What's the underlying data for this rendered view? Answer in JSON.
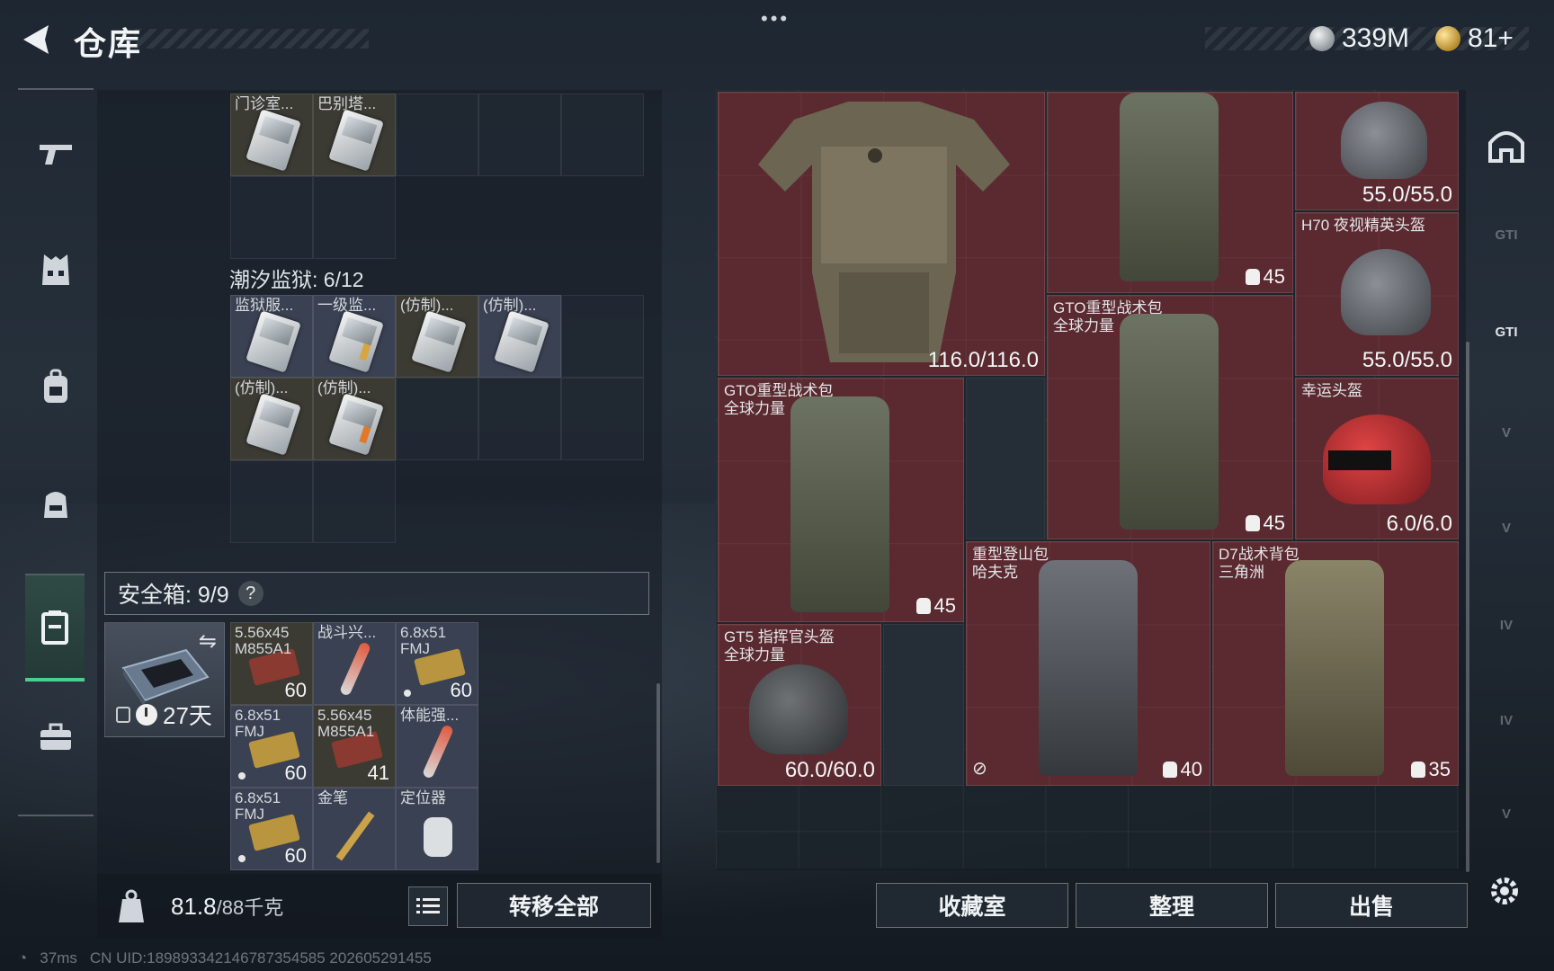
{
  "header": {
    "title": "仓库",
    "menu_dots": "•••",
    "currency": [
      {
        "name": "silver-coin-icon",
        "value": "339M"
      },
      {
        "name": "gold-coin-icon",
        "value": "81+"
      }
    ]
  },
  "stash": {
    "top_items": [
      {
        "label": "门诊室...",
        "style": "tan"
      },
      {
        "label": "巴别塔...",
        "style": "tan"
      }
    ],
    "section_title": "潮汐监狱: 6/12",
    "prison_items": [
      {
        "label": "监狱服...",
        "style": "blue"
      },
      {
        "label": "一级监...",
        "style": "blue",
        "accent": "gold"
      },
      {
        "label": "(仿制)...",
        "style": "tan"
      },
      {
        "label": "(仿制)...",
        "style": "blue"
      },
      {
        "label": "(仿制)...",
        "style": "tan"
      },
      {
        "label": "(仿制)...",
        "style": "tan",
        "accent": "orange"
      }
    ]
  },
  "safe_box": {
    "title": "安全箱: 9/9",
    "help": "?",
    "duration": "27天",
    "items": [
      {
        "label": "5.56x45\nM855A1",
        "qty": "60",
        "type": "ammo-red"
      },
      {
        "label": "战斗兴...",
        "qty": "",
        "type": "injector"
      },
      {
        "label": "6.8x51\nFMJ",
        "qty": "60",
        "type": "ammo-gold",
        "dot": true
      },
      {
        "label": "6.8x51\nFMJ",
        "qty": "60",
        "type": "ammo-gold",
        "dot": true
      },
      {
        "label": "5.56x45\nM855A1",
        "qty": "41",
        "type": "ammo-red"
      },
      {
        "label": "体能强...",
        "qty": "",
        "type": "injector"
      },
      {
        "label": "6.8x51\nFMJ",
        "qty": "60",
        "type": "ammo-gold",
        "dot": true
      },
      {
        "label": "金笔",
        "qty": "",
        "type": "pen"
      },
      {
        "label": "定位器",
        "qty": "",
        "type": "locator"
      }
    ]
  },
  "footer_left": {
    "weight_current": "81.8",
    "weight_max": "/88千克",
    "transfer_all": "转移全部"
  },
  "equipment": {
    "armor": {
      "value": "116.0/116.0"
    },
    "pack_top": {
      "capacity": "45"
    },
    "helmet_top": {
      "value": "55.0/55.0"
    },
    "helmet_h70": {
      "label": "H70 夜视精英头盔",
      "value": "55.0/55.0"
    },
    "pack_gto_center": {
      "label": "GTO重型战术包\n全球力量",
      "capacity": "45"
    },
    "pack_gto_left": {
      "label": "GTO重型战术包\n全球力量",
      "capacity": "45"
    },
    "helmet_lucky": {
      "label": "幸运头盔",
      "value": "6.0/6.0"
    },
    "helmet_gt5": {
      "label": "GT5 指挥官头盔\n全球力量",
      "value": "60.0/60.0"
    },
    "pack_hafuke": {
      "label": "重型登山包\n哈夫克",
      "capacity": "40"
    },
    "pack_d7": {
      "label": "D7战术背包\n三角洲",
      "capacity": "35"
    }
  },
  "footer_right": {
    "collection": "收藏室",
    "sort": "整理",
    "sell": "出售"
  },
  "right_nav": [
    {
      "name": "helmet-tab",
      "label": ""
    },
    {
      "name": "tab-gti-a",
      "label": "GTI"
    },
    {
      "name": "tab-gti-b",
      "label": "GTI"
    },
    {
      "name": "tab-v-a",
      "label": "V"
    },
    {
      "name": "tab-v-b",
      "label": "V"
    },
    {
      "name": "tab-iv-a",
      "label": "IV"
    },
    {
      "name": "tab-iv-b",
      "label": "IV"
    },
    {
      "name": "tab-v-c",
      "label": "V"
    }
  ],
  "status": {
    "ping": "37ms",
    "uid": "CN UID:189893342146787354585 202605291455"
  },
  "colors": {
    "accent_green": "#49d08a",
    "equip_red": "#5a2a30",
    "panel": "#1e2731"
  }
}
